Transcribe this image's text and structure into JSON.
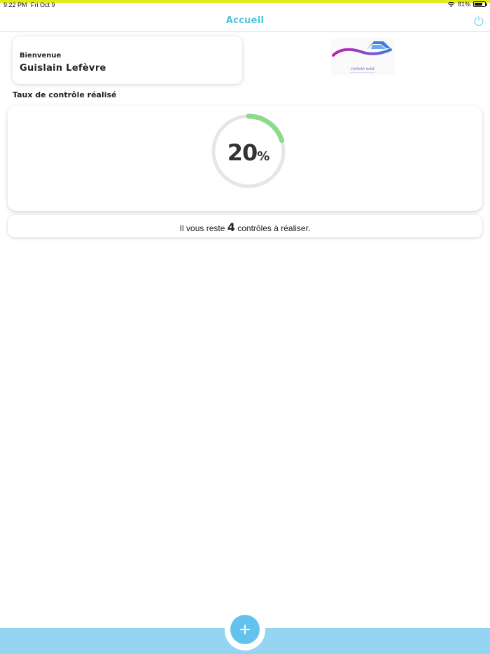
{
  "status_bar": {
    "time": "9:22 PM",
    "date": "Fri Oct 9",
    "battery": "81%",
    "battery_level": 0.81
  },
  "nav": {
    "title": "Accueil",
    "power_icon": "power-icon"
  },
  "welcome": {
    "label": "Bienvenue",
    "name": "Guislain  Lefèvre"
  },
  "logo": {
    "text": "COMPANY NAME"
  },
  "progress": {
    "section_title": "Taux de contrôle réalisé",
    "value": "20",
    "unit": "%",
    "fraction": 0.2,
    "track_color": "#e6e6e6",
    "fill_color": "#8fd98a"
  },
  "remaining": {
    "prefix": "Il vous reste ",
    "count": "4",
    "suffix": " contrôles à réaliser."
  },
  "bottom_bar": {
    "add_icon": "plus-icon",
    "color": "#95d5f2"
  }
}
